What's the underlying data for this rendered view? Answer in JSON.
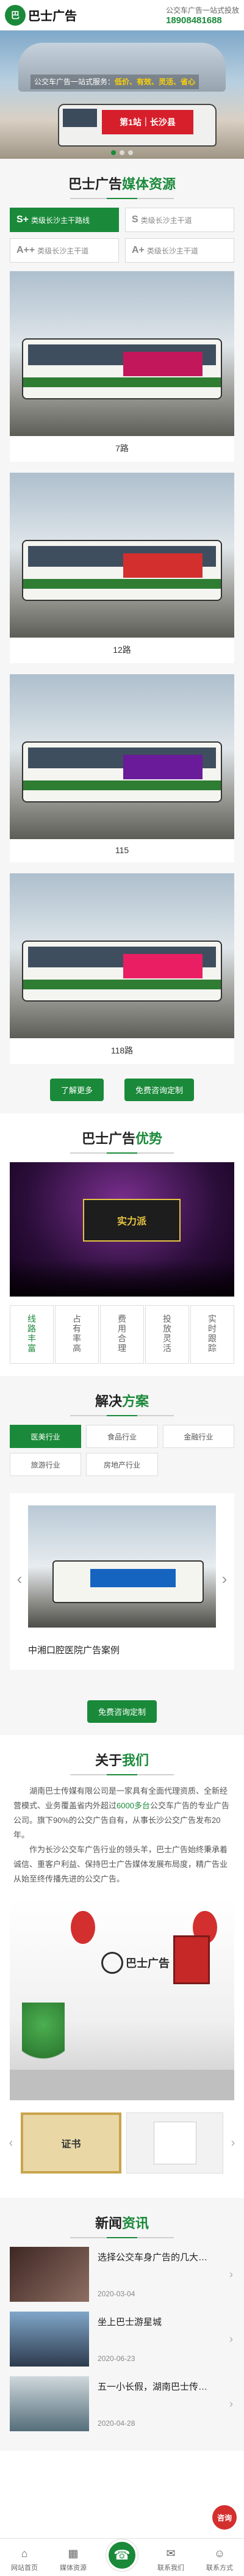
{
  "header": {
    "logo_mark": "巴",
    "logo_text": "巴士广告",
    "subtitle": "公交车广告一站式投放",
    "phone": "18908481688"
  },
  "banner": {
    "line1": "公交车广告一站式服务：",
    "line1_hl": "低价、有效、灵活、省心",
    "bus_ad": "第1站｜长沙县"
  },
  "resources": {
    "title_main": "巴士广告",
    "title_hl": "媒体资源",
    "tabs": [
      {
        "prefix": "S+",
        "label": "类级长沙主干路线"
      },
      {
        "prefix": "S",
        "label": "类级长沙主干道"
      },
      {
        "prefix": "A++",
        "label": "类级长沙主干道"
      },
      {
        "prefix": "A+",
        "label": "类级长沙主干道"
      }
    ],
    "cards": [
      {
        "caption": "7路"
      },
      {
        "caption": "12路"
      },
      {
        "caption": "115"
      },
      {
        "caption": "118路"
      }
    ],
    "btn_more": "了解更多",
    "btn_custom": "免费咨询定制"
  },
  "advantages": {
    "title_main": "巴士广告",
    "title_hl": "优势",
    "screen_text": "实力派",
    "tabs": [
      "线路丰富",
      "占有率高",
      "费用合理",
      "投放灵活",
      "实时跟踪"
    ]
  },
  "solutions": {
    "title_main": "解决",
    "title_hl": "方案",
    "tabs": [
      "医美行业",
      "食品行业",
      "金融行业",
      "旅游行业",
      "房地产行业"
    ],
    "case_title": "中湘口腔医院广告案例",
    "btn": "免费咨询定制"
  },
  "about": {
    "title_main": "关于",
    "title_hl": "我们",
    "paragraph1_a": "湖南巴士传媒有限公司是一家具有全面代理资质、全新经营模式、业务覆盖省内外超过",
    "paragraph1_hl": "6000多台",
    "paragraph1_b": "公交车广告的专业广告公司。旗下90%的公交广告自有，从事长沙公交广告发布20年。",
    "paragraph2": "作为长沙公交车广告行业的领头羊，巴士广告始终秉承着诚信、重客户利益、保持巴士广告媒体发展布局度，精广告业从始至终传播先进的公交广告。",
    "wall_logo": "巴士广告",
    "cert_text": "证书"
  },
  "news": {
    "title_main": "新闻",
    "title_hl": "资讯",
    "items": [
      {
        "title": "选择公交车身广告的几大…",
        "date": "2020-03-04"
      },
      {
        "title": "坐上巴士游星城",
        "date": "2020-06-23"
      },
      {
        "title": "五一小长假，湖南巴士传…",
        "date": "2020-04-28"
      }
    ]
  },
  "bottombar": {
    "home": "网站首页",
    "cases": "媒体资源",
    "call": "☎",
    "contact": "联系我们",
    "more": "联系方式"
  },
  "ask_label": "咨询",
  "colors": {
    "accent": "#1a8a3a",
    "alert": "#d32f2f"
  }
}
